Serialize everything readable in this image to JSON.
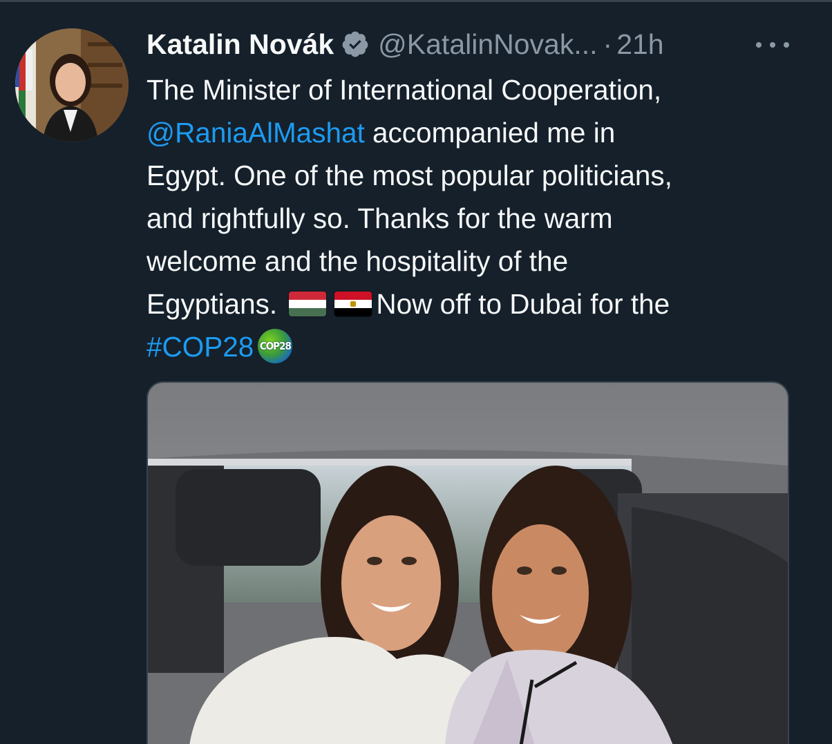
{
  "tweet": {
    "author_name": "Katalin Novák",
    "handle": "@KatalinNovak...",
    "separator": "·",
    "time": "21h",
    "text_lines": [
      "The Minister of International Cooperation,",
      "accompanied me in",
      "Egypt. One of the most popular politicians,",
      "and rightfully so. Thanks for the warm",
      "welcome and the hospitality of the",
      "Egyptians.",
      "Now off to Dubai for the"
    ],
    "mention": "@RaniaAlMashat",
    "hashtag": "#COP28",
    "cop_badge_text": "COP28"
  },
  "icons": {
    "verified": "verified-badge-icon",
    "more": "more-options-icon",
    "flag_hungary": "hungary-flag-emoji",
    "flag_egypt": "egypt-flag-emoji",
    "cop28": "cop28-globe-emoji"
  },
  "colors": {
    "background": "#15202b",
    "text": "#f7f9f9",
    "secondary": "#8b98a5",
    "link": "#1d9bf0"
  }
}
